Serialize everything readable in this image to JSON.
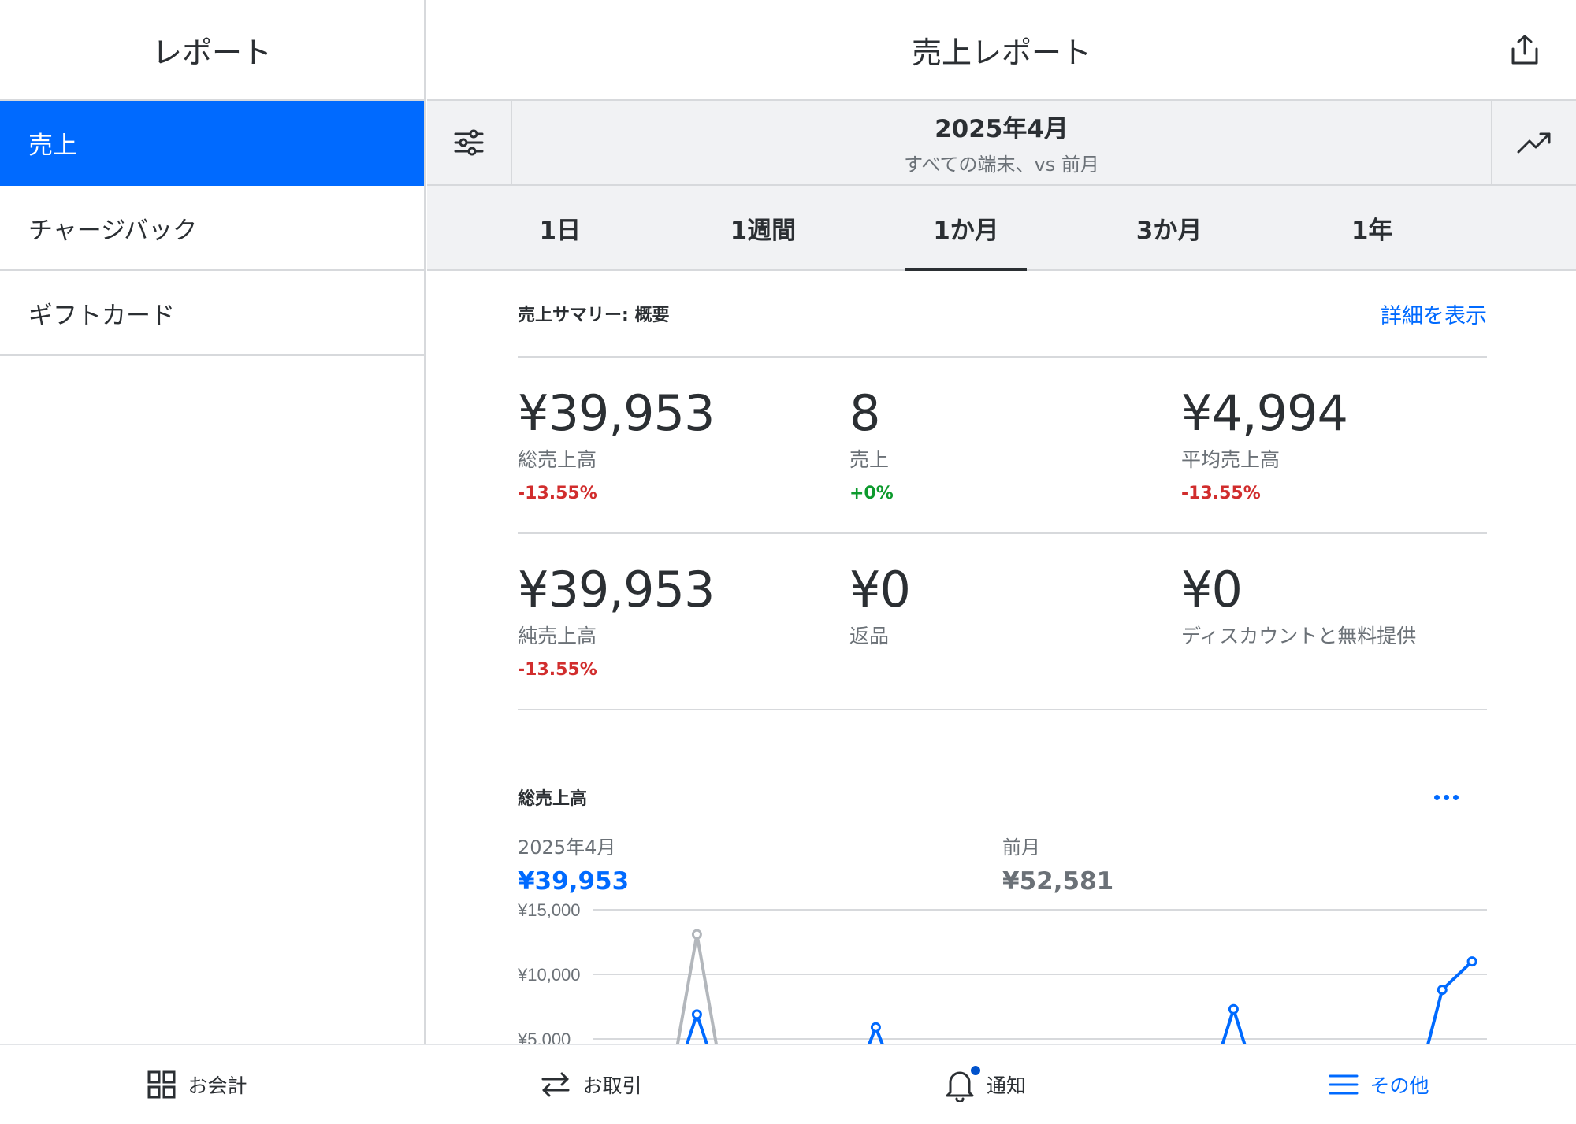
{
  "sidebar": {
    "title": "レポート",
    "items": [
      {
        "label": "売上"
      },
      {
        "label": "チャージバック"
      },
      {
        "label": "ギフトカード"
      }
    ]
  },
  "header": {
    "title": "売上レポート"
  },
  "period": {
    "title": "2025年4月",
    "subtitle": "すべての端末、vs 前月"
  },
  "ranges": [
    {
      "label": "1日"
    },
    {
      "label": "1週間"
    },
    {
      "label": "1か月"
    },
    {
      "label": "3か月"
    },
    {
      "label": "1年"
    }
  ],
  "active_range": "1か月",
  "summary": {
    "title": "売上サマリー: 概要",
    "link": "詳細を表示",
    "rows": [
      [
        {
          "value": "¥39,953",
          "label": "総売上高",
          "change": "-13.55%",
          "trend": "neg"
        },
        {
          "value": "8",
          "label": "売上",
          "change": "+0%",
          "trend": "pos"
        },
        {
          "value": "¥4,994",
          "label": "平均売上高",
          "change": "-13.55%",
          "trend": "neg"
        }
      ],
      [
        {
          "value": "¥39,953",
          "label": "純売上高",
          "change": "-13.55%",
          "trend": "neg"
        },
        {
          "value": "¥0",
          "label": "返品",
          "change": "",
          "trend": ""
        },
        {
          "value": "¥0",
          "label": "ディスカウントと無料提供",
          "change": "",
          "trend": ""
        }
      ]
    ]
  },
  "gross_chart": {
    "title": "総売上高",
    "current": {
      "label": "2025年4月",
      "value": "¥39,953"
    },
    "previous": {
      "label": "前月",
      "value": "¥52,581"
    }
  },
  "chart_data": {
    "type": "line",
    "title": "総売上高",
    "y_ticks": [
      "¥15,000",
      "¥10,000",
      "¥5,000"
    ],
    "ylim": [
      0,
      15000
    ],
    "x": [
      1,
      2,
      3,
      4,
      5,
      6,
      7,
      8,
      9,
      10,
      11,
      12,
      13,
      14,
      15,
      16,
      17,
      18,
      19,
      20,
      21,
      22,
      23,
      24,
      25,
      26,
      27,
      28,
      29,
      30
    ],
    "series": [
      {
        "name": "2025年4月",
        "color": "#006aff",
        "values": [
          0,
          0,
          0,
          6900,
          0,
          0,
          0,
          0,
          0,
          5900,
          0,
          0,
          0,
          0,
          0,
          0,
          0,
          0,
          0,
          0,
          0,
          7300,
          0,
          0,
          0,
          0,
          0,
          0,
          8800,
          0
        ]
      },
      {
        "name": "前月",
        "color": "#b3b7bc",
        "values": [
          0,
          0,
          0,
          13100,
          0,
          0,
          0,
          0,
          0,
          0,
          0,
          0,
          0,
          0,
          0,
          0,
          0,
          0,
          0,
          0,
          0,
          0,
          0,
          0,
          0,
          0,
          0,
          0,
          0,
          0
        ]
      }
    ],
    "extra_peak": {
      "x": 30,
      "value": 11000
    }
  },
  "bottom_nav": [
    {
      "label": "お会計",
      "icon": "grid-icon"
    },
    {
      "label": "お取引",
      "icon": "swap-arrows-icon"
    },
    {
      "label": "通知",
      "icon": "bell-icon"
    },
    {
      "label": "その他",
      "icon": "menu-icon"
    }
  ],
  "colors": {
    "accent": "#006aff",
    "negative": "#d12d2d",
    "positive": "#0d9a2d"
  }
}
